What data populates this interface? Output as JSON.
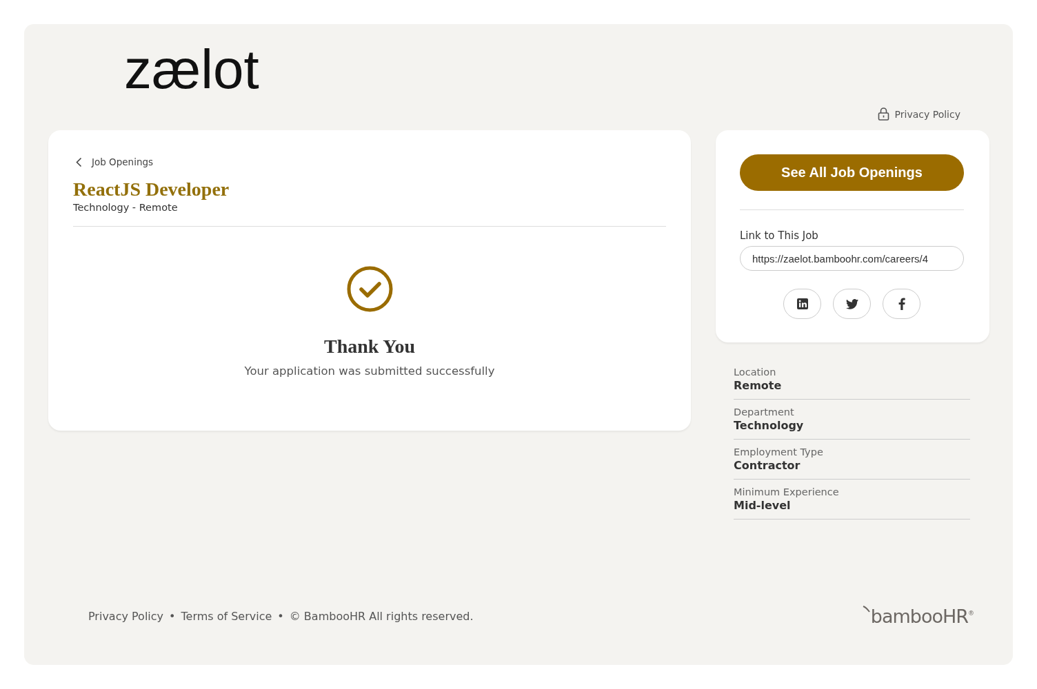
{
  "logo": {
    "text": "zælot"
  },
  "header": {
    "privacy_link": "Privacy Policy"
  },
  "job": {
    "back_link": "Job Openings",
    "title": "ReactJS Developer",
    "subtitle": "Technology - Remote"
  },
  "confirmation": {
    "title": "Thank You",
    "message": "Your application was submitted successfully"
  },
  "sidebar": {
    "button": "See All Job Openings",
    "link_label": "Link to This Job",
    "link_value": "https://zaelot.bamboohr.com/careers/4",
    "share": [
      {
        "kind": "linkedin"
      },
      {
        "kind": "twitter"
      },
      {
        "kind": "facebook"
      }
    ]
  },
  "details": [
    {
      "label": "Location",
      "value": "Remote"
    },
    {
      "label": "Department",
      "value": "Technology"
    },
    {
      "label": "Employment Type",
      "value": "Contractor"
    },
    {
      "label": "Minimum Experience",
      "value": "Mid-level"
    }
  ],
  "footer": {
    "links": [
      "Privacy Policy",
      "Terms of Service"
    ],
    "copyright": "© BambooHR All rights reserved.",
    "separator": "•",
    "brand": "bambooHR",
    "brand_mark": "®"
  }
}
